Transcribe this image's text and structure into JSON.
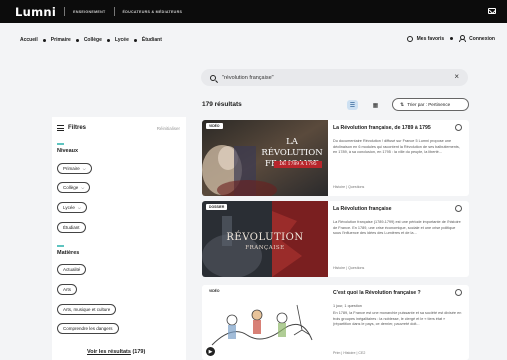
{
  "topbar": {
    "logo": "Lumni",
    "links": [
      "ENSEIGNEMENT",
      "ÉDUCATEURS & MÉDIATEURS"
    ]
  },
  "breadcrumb": [
    "Accueil",
    "Primaire",
    "Collège",
    "Lycée",
    "Étudiant"
  ],
  "header_links": {
    "favorites": "Mes favoris",
    "login": "Connexion"
  },
  "search": {
    "value": "\"révolution française\""
  },
  "results": {
    "count_label": "179 résultats",
    "sort_label": "Trier par : Pertinence"
  },
  "filters": {
    "title": "Filtres",
    "reset_label": "Réinitialiser",
    "niveaux": {
      "title": "Niveaux",
      "items": [
        "Primaire",
        "Collège",
        "Lycée",
        "Étudiant"
      ]
    },
    "matieres": {
      "title": "Matières",
      "items": [
        "Actualité",
        "Arts",
        "Arts, musique et culture",
        "Comprendre les dangers"
      ]
    },
    "see_results": {
      "label": "Voir les résultats",
      "count": "(179)"
    }
  },
  "cards": [
    {
      "badge": "VIDÉO",
      "thumb_title": "LA RÉVOLUTION FRANÇAISE",
      "thumb_sub": "DE 1789 À 1795",
      "title": "La Révolution française, de 1789 à 1795",
      "desc": "Du documentaire Révolution ! diffusé sur France 5 Lumni propose une déclinaison en 6 modules qui racontent la Révolution de ses balbutiements, en 1789, à sa conclusion, en 1795 : la ville du peuple, la liberté...",
      "meta": "Histoire | Questions"
    },
    {
      "badge": "DOSSIER",
      "thumb_title": "RÉVOLUTION",
      "thumb_sub": "FRANÇAISE",
      "title": "La Révolution française",
      "desc": "La Révolution française (1789-1799) est une période importante de l'histoire de France. En 1789, une crise économique, sociale et une crise politique sous l'influence des idées des Lumières et de la...",
      "meta": "Histoire | Questions"
    },
    {
      "badge": "VIDÉO",
      "title": "C'est quoi la Révolution française ?",
      "sub": "1 jour, 1 question",
      "desc": "En 1789, la France est une monarchie puissante et sa société est divisée en trois groupes inégalitaires : la noblesse, le clergé et le « tiers état » (répartition dans le pays, ce dernier, pauvreté doit...",
      "meta": "Prim | Histoire | CE2"
    }
  ]
}
